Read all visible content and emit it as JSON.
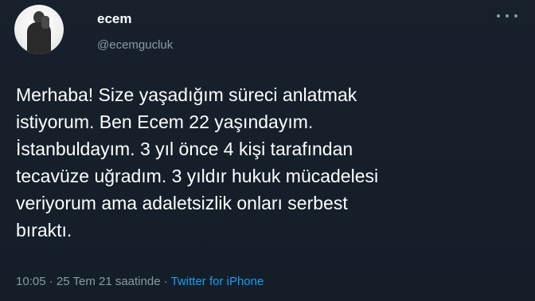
{
  "user": {
    "display_name": "ecem",
    "handle": "@ecemgucluk"
  },
  "icons": {
    "more": "more-options-icon",
    "avatar": "profile-photo"
  },
  "tweet": {
    "text": "Merhaba! Size yaşadığım süreci anlatmak\nistiyorum. Ben Ecem 22 yaşındayım.\nİstanbuldayım. 3 yıl önce 4 kişi tarafından\ntecavüze uğradım. 3 yıldır hukuk mücadelesi\nveriyorum ama adaletsizlik onları serbest\nbıraktı."
  },
  "meta": {
    "time": "10:05",
    "separator": " · ",
    "date": "25 Tem 21 saatinde",
    "separator2": " · ",
    "source": "Twitter for iPhone"
  },
  "colors": {
    "background": "#15202b",
    "text": "#ffffff",
    "secondary": "#8899a6",
    "link": "#1d9bf0"
  }
}
